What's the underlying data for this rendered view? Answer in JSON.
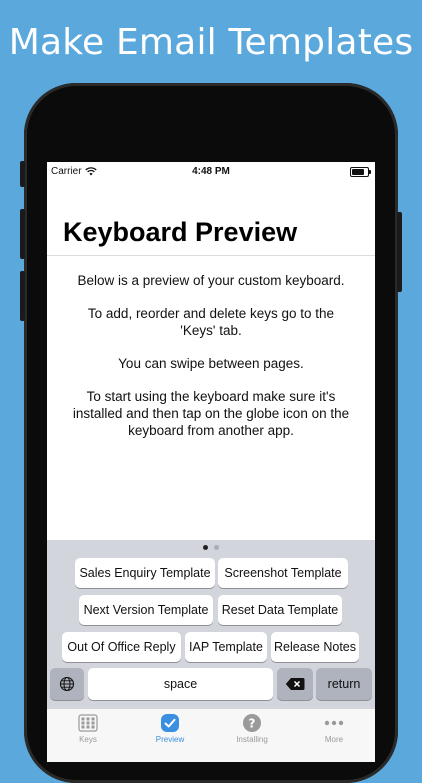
{
  "headline": "Make Email Templates",
  "status": {
    "carrier": "Carrier",
    "time": "4:48 PM"
  },
  "title": "Keyboard Preview",
  "paragraphs": [
    "Below is a preview of your custom keyboard.",
    "To add, reorder and delete keys go to the 'Keys' tab.",
    "You can swipe between pages.",
    "To start using the keyboard make sure it's installed and then tap on the globe icon on the keyboard from another app."
  ],
  "keyboard": {
    "pages": 2,
    "current_page": 1,
    "keys": [
      "Sales Enquiry Template",
      "Screenshot Template",
      "Next Version Template",
      "Reset Data Template",
      "Out Of Office Reply",
      "IAP Template",
      "Release Notes"
    ],
    "space": "space",
    "return": "return",
    "globe_icon": "globe-icon",
    "delete_icon": "delete-backspace-icon"
  },
  "tabs": [
    {
      "label": "Keys",
      "icon": "keyboard-grid-icon",
      "active": false
    },
    {
      "label": "Preview",
      "icon": "checkmark-badge-icon",
      "active": true
    },
    {
      "label": "Installing",
      "icon": "question-circle-icon",
      "active": false
    },
    {
      "label": "More",
      "icon": "more-dots-icon",
      "active": false
    }
  ],
  "colors": {
    "background": "#5aa8dc",
    "accent": "#3a8fe0",
    "keyboard_bg": "#d2d5db"
  }
}
